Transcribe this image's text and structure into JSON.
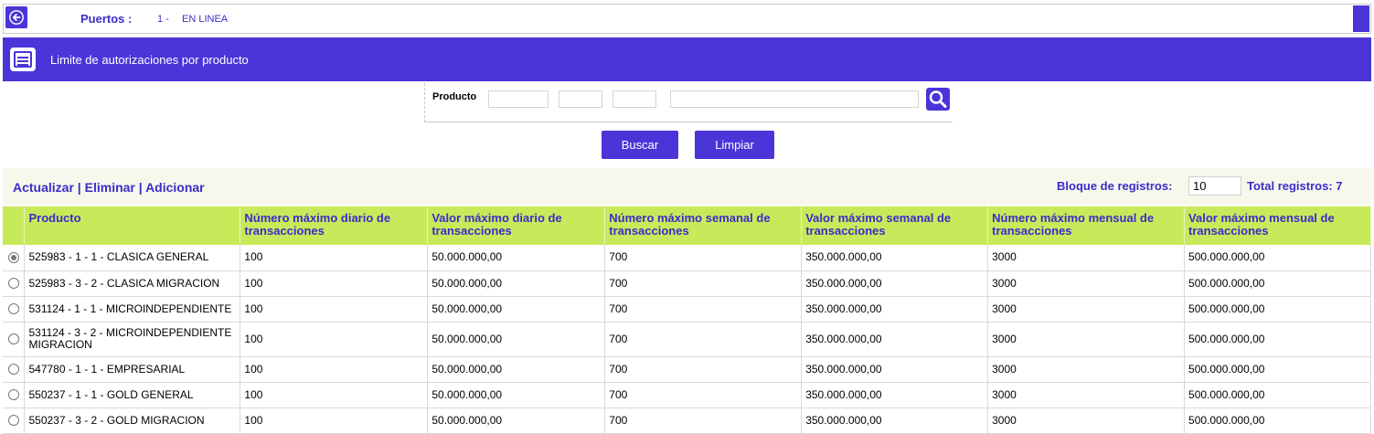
{
  "header": {
    "puertos_label": "Puertos :",
    "puertos_num": "1 -",
    "puertos_status": "EN LINEA"
  },
  "title": "Limite de autorizaciones por producto",
  "filter": {
    "label": "Producto"
  },
  "buttons": {
    "buscar": "Buscar",
    "limpiar": "Limpiar"
  },
  "toolbar": {
    "actualizar": "Actualizar",
    "sep1": " | ",
    "eliminar": "Eliminar",
    "sep2": " | ",
    "adicionar": "Adicionar",
    "bloque_label": "Bloque de registros:",
    "bloque_value": "10",
    "total": "Total registros: 7"
  },
  "table": {
    "columns": [
      "Producto",
      "Número máximo diario de transacciones",
      "Valor máximo diario de transacciones",
      "Número máximo semanal de transacciones",
      "Valor máximo semanal de transacciones",
      "Número máximo mensual de transacciones",
      "Valor máximo mensual de transacciones"
    ],
    "rows": [
      {
        "producto": "525983 - 1 - 1 - CLASICA GENERAL",
        "n_diario": "100",
        "v_diario": "50.000.000,00",
        "n_semanal": "700",
        "v_semanal": "350.000.000,00",
        "n_mensual": "3000",
        "v_mensual": "500.000.000,00",
        "selected": true
      },
      {
        "producto": "525983 - 3 - 2 - CLASICA MIGRACION",
        "n_diario": "100",
        "v_diario": "50.000.000,00",
        "n_semanal": "700",
        "v_semanal": "350.000.000,00",
        "n_mensual": "3000",
        "v_mensual": "500.000.000,00",
        "selected": false
      },
      {
        "producto": "531124 - 1 - 1 - MICROINDEPENDIENTE",
        "n_diario": "100",
        "v_diario": "50.000.000,00",
        "n_semanal": "700",
        "v_semanal": "350.000.000,00",
        "n_mensual": "3000",
        "v_mensual": "500.000.000,00",
        "selected": false
      },
      {
        "producto": "531124 - 3 - 2 - MICROINDEPENDIENTE MIGRACION",
        "n_diario": "100",
        "v_diario": "50.000.000,00",
        "n_semanal": "700",
        "v_semanal": "350.000.000,00",
        "n_mensual": "3000",
        "v_mensual": "500.000.000,00",
        "selected": false
      },
      {
        "producto": "547780 - 1 - 1 - EMPRESARIAL",
        "n_diario": "100",
        "v_diario": "50.000.000,00",
        "n_semanal": "700",
        "v_semanal": "350.000.000,00",
        "n_mensual": "3000",
        "v_mensual": "500.000.000,00",
        "selected": false
      },
      {
        "producto": "550237 - 1 - 1 - GOLD GENERAL",
        "n_diario": "100",
        "v_diario": "50.000.000,00",
        "n_semanal": "700",
        "v_semanal": "350.000.000,00",
        "n_mensual": "3000",
        "v_mensual": "500.000.000,00",
        "selected": false
      },
      {
        "producto": "550237 - 3 - 2 - GOLD MIGRACION",
        "n_diario": "100",
        "v_diario": "50.000.000,00",
        "n_semanal": "700",
        "v_semanal": "350.000.000,00",
        "n_mensual": "3000",
        "v_mensual": "500.000.000,00",
        "selected": false
      }
    ]
  },
  "icons": {
    "back": "arrow-left-icon",
    "title": "list-card-icon",
    "search": "search-icon"
  },
  "colors": {
    "brand": "#4a35d8",
    "header_row": "#c8ea5a",
    "toolbar_bg": "#f7f8ec"
  }
}
